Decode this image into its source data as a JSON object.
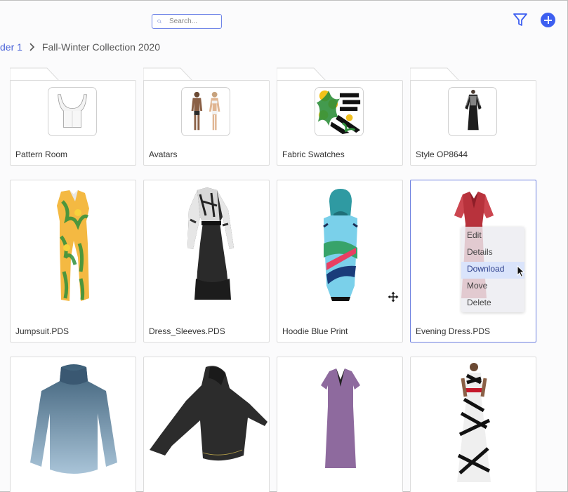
{
  "header": {
    "search_placeholder": "Search...",
    "filter_icon": "filter-icon",
    "add_icon": "plus-circle-icon",
    "accent_color": "#3d5ff0"
  },
  "breadcrumb": {
    "parent": "der 1",
    "current": "Fall-Winter Collection 2020"
  },
  "folders": [
    {
      "name": "Pattern Room"
    },
    {
      "name": "Avatars"
    },
    {
      "name": "Fabric Swatches"
    },
    {
      "name": "Style OP8644"
    }
  ],
  "files": [
    {
      "name": "Jumpsuit.PDS"
    },
    {
      "name": "Dress_Sleeves.PDS"
    },
    {
      "name": "Hoodie Blue Print"
    },
    {
      "name": "Evening Dress.PDS"
    }
  ],
  "context_menu": {
    "items": [
      "Edit",
      "Details",
      "Download",
      "Move",
      "Delete"
    ],
    "active": "Download"
  }
}
